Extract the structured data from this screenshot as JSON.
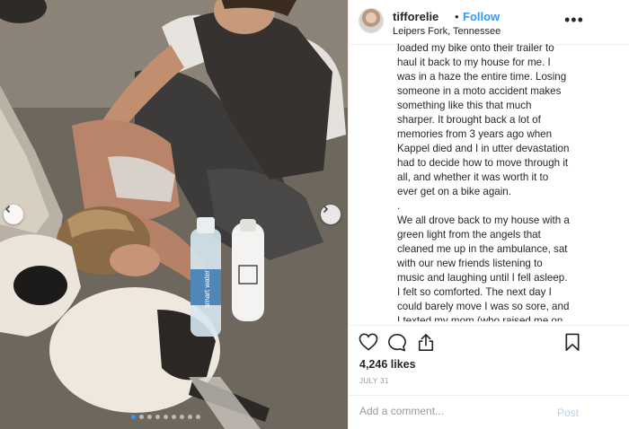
{
  "post": {
    "username": "tifforelie",
    "separator": "•",
    "follow_label": "Follow",
    "location": "Leipers Fork, Tennessee",
    "more_label": "•••",
    "caption": "loaded my bike onto their trailer to\nhaul it back to my house for me. I\nwas in a haze the entire time. Losing\nsomeone in a moto accident makes\nsomething like this that much\nsharper. It brought back a lot of\nmemories from 3 years ago when\nKappel died and I in utter devastation\nhad to decide how to move through it\nall, and whether it was worth it to\never get on a bike again.\n.\nWe all drove back to my house with a\ngreen light from the angels that\ncleaned me up in the ambulance, sat\nwith our new friends listening to\nmusic and laughing until I fell asleep.\nI felt so comforted. The next day I\ncould barely move I was so sore, and\nI texted my mom (who raised me on\nthe back of HER motorcycle) to tell",
    "likes": "4,246 likes",
    "date": "JULY 31",
    "comment_placeholder": "Add a comment...",
    "post_label": "Post"
  },
  "photo": {
    "bottle_label": "smart water",
    "carousel_dots": 9,
    "active_dot": 0
  },
  "icons": {
    "like": "heart-icon",
    "comment": "comment-icon",
    "share": "share-icon",
    "save": "bookmark-icon",
    "prev": "chevron-left-icon",
    "next": "chevron-right-icon"
  },
  "colors": {
    "accent": "#3897f0",
    "text": "#262626",
    "muted": "#999999",
    "post_disabled": "#b3d4f5"
  }
}
